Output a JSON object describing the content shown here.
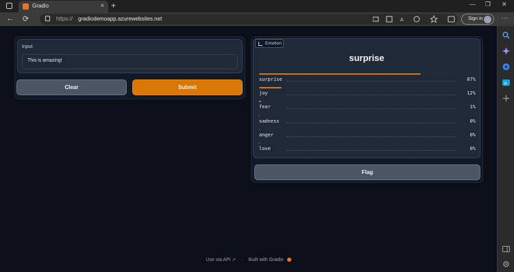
{
  "browser": {
    "tab_title": "Gradio",
    "tab_close": "×",
    "new_tab": "+",
    "url_proto": "https://",
    "url_host": "gradiodemoapp.azurewebsites.net",
    "signin_label": "Sign in",
    "back": "←",
    "refresh": "⟳",
    "more": "···",
    "win_minimize": "—",
    "win_restore": "❐",
    "win_close": "✕"
  },
  "input_panel": {
    "label": "Input",
    "value": "This is amazing!",
    "clear_label": "Clear",
    "submit_label": "Submit"
  },
  "output_panel": {
    "tag_label": "Emotion",
    "top_label": "surprise",
    "confidences": [
      {
        "label": "surprise",
        "value": "87%",
        "fraction": 0.87
      },
      {
        "label": "joy",
        "value": "12%",
        "fraction": 0.12
      },
      {
        "label": "fear",
        "value": "1%",
        "fraction": 0.01
      },
      {
        "label": "sadness",
        "value": "0%",
        "fraction": 0.0
      },
      {
        "label": "anger",
        "value": "0%",
        "fraction": 0.0
      },
      {
        "label": "love",
        "value": "0%",
        "fraction": 0.0
      }
    ],
    "flag_label": "Flag"
  },
  "footer": {
    "api_text": "Use via API",
    "separator": "·",
    "built_text": "Built with Gradio"
  },
  "colors": {
    "accent": "#d97706",
    "background": "#0b0f19"
  }
}
